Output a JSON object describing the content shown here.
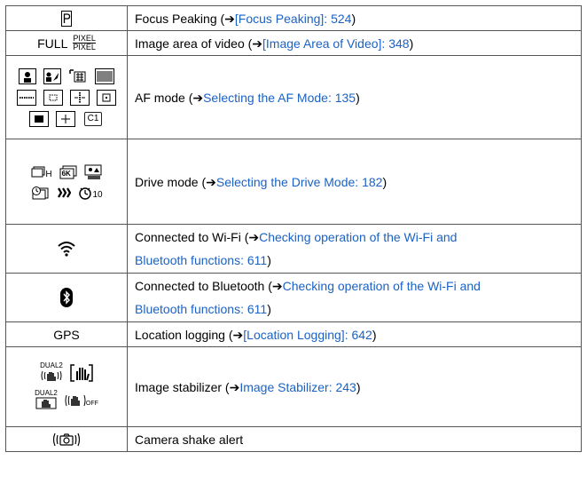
{
  "rows": [
    {
      "icon_name": "focus-peaking-p-icon",
      "desc_text": "Focus Peaking (",
      "arrow": "➔",
      "link_text": "[Focus Peaking]: 524",
      "close": ")"
    },
    {
      "icon_text": "FULL",
      "icon_pixel_top": "PIXEL",
      "icon_pixel_bottom": "PIXEL",
      "desc_text": "Image area of video (",
      "arrow": "➔",
      "link_text": "[Image Area of Video]: 348",
      "close": ")"
    },
    {
      "icon_names": [
        "af-face-eye-icon",
        "af-animal-icon",
        "af-tracking-icon",
        "af-225-area-icon",
        "af-zone-horizontal-icon",
        "af-zone-square-icon",
        "af-zone-vertical-icon",
        "af-1-area-plus-icon",
        "af-1-area-icon",
        "af-pinpoint-icon",
        "af-custom-c1-icon"
      ],
      "custom_label": "C1",
      "desc_text": "AF mode (",
      "arrow": "➔",
      "link_text": "Selecting the AF Mode: 135",
      "close": ")"
    },
    {
      "icon_names": [
        "burst-h-icon",
        "6k-photo-icon",
        "post-focus-icon",
        "self-timer-burst-icon",
        "interval-shooting-icon",
        "self-timer-10-icon"
      ],
      "burst_label": "H",
      "sixk_label": "6K",
      "timer_label": "10",
      "desc_text": "Drive mode (",
      "arrow": "➔",
      "link_text": "Selecting the Drive Mode: 182",
      "close": ")"
    },
    {
      "icon_name": "wifi-icon",
      "desc_text": "Connected to Wi-Fi (",
      "arrow": "➔",
      "link_text_1": "Checking operation of the Wi-Fi and",
      "link_text_2": "Bluetooth functions: 611",
      "close": ")"
    },
    {
      "icon_name": "bluetooth-icon",
      "desc_text": "Connected to Bluetooth (",
      "arrow": "➔",
      "link_text_1": "Checking operation of the Wi-Fi and",
      "link_text_2": "Bluetooth functions: 611",
      "close": ")"
    },
    {
      "icon_text": "GPS",
      "desc_text": "Location logging (",
      "arrow": "➔",
      "link_text": "[Location Logging]: 642",
      "close": ")"
    },
    {
      "icon_names": [
        "dual2-stabilizer-icon",
        "stabilizer-on-icon",
        "dual2-stabilizer-alt-icon",
        "stabilizer-off-icon"
      ],
      "dual_label": "DUAL2",
      "off_label": "OFF",
      "desc_text": "Image stabilizer (",
      "arrow": "➔",
      "link_text": "Image Stabilizer: 243",
      "close": ")"
    },
    {
      "icon_name": "camera-shake-alert-icon",
      "desc_text": "Camera shake alert"
    }
  ]
}
